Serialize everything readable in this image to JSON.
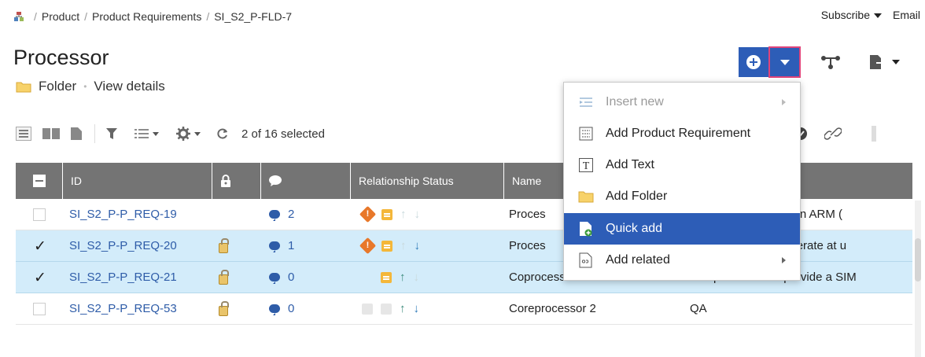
{
  "breadcrumb": {
    "items": [
      "Product",
      "Product Requirements",
      "SI_S2_P-FLD-7"
    ]
  },
  "header_links": {
    "subscribe": "Subscribe",
    "email": "Email"
  },
  "page": {
    "title": "Processor",
    "type": "Folder",
    "view_details": "View details"
  },
  "toolbar": {
    "selection": "2 of 16 selected"
  },
  "table": {
    "columns": [
      "ID",
      "Relationship Status",
      "Name"
    ],
    "rows": [
      {
        "id": "SI_S2_P-P_REQ-19",
        "selected": false,
        "locked": false,
        "comments": "2",
        "name": "Proces",
        "description": "all use an ARM (",
        "relationship": [
          "warning-orange",
          "doc",
          "up-faint",
          "down-faint"
        ]
      },
      {
        "id": "SI_S2_P-P_REQ-20",
        "selected": true,
        "locked": true,
        "comments": "1",
        "name": "Proces",
        "description": "shall operate at u",
        "relationship": [
          "warning-orange",
          "doc",
          "up-faint",
          "down"
        ]
      },
      {
        "id": "SI_S2_P-P_REQ-21",
        "selected": true,
        "locked": true,
        "comments": "0",
        "name": "Coprocessors",
        "description": "The product shall provide a SIM",
        "relationship": [
          "faint",
          "doc",
          "up",
          "down-faint"
        ]
      },
      {
        "id": "SI_S2_P-P_REQ-53",
        "selected": false,
        "locked": true,
        "comments": "0",
        "name": "Coreprocessor 2",
        "description": "QA",
        "relationship": [
          "faint",
          "faint",
          "up",
          "down"
        ]
      }
    ]
  },
  "menu": {
    "items": [
      {
        "label": "Insert new",
        "icon": "insert-icon",
        "disabled": true,
        "submenu": true
      },
      {
        "label": "Add Product Requirement",
        "icon": "requirement-icon",
        "disabled": false,
        "submenu": false
      },
      {
        "label": "Add Text",
        "icon": "text-icon",
        "disabled": false,
        "submenu": false
      },
      {
        "label": "Add Folder",
        "icon": "folder-icon",
        "disabled": false,
        "submenu": false
      },
      {
        "label": "Quick add",
        "icon": "quick-add-icon",
        "disabled": false,
        "highlighted": true,
        "submenu": false
      },
      {
        "label": "Add related",
        "icon": "link-icon",
        "disabled": false,
        "submenu": true
      }
    ]
  },
  "colors": {
    "primary": "#2d5db7",
    "header_gray": "#747474",
    "selected_row": "#d3ecfa",
    "link_blue": "#2e5ca8",
    "warning": "#e8782a",
    "doc_yellow": "#f4b73a"
  }
}
